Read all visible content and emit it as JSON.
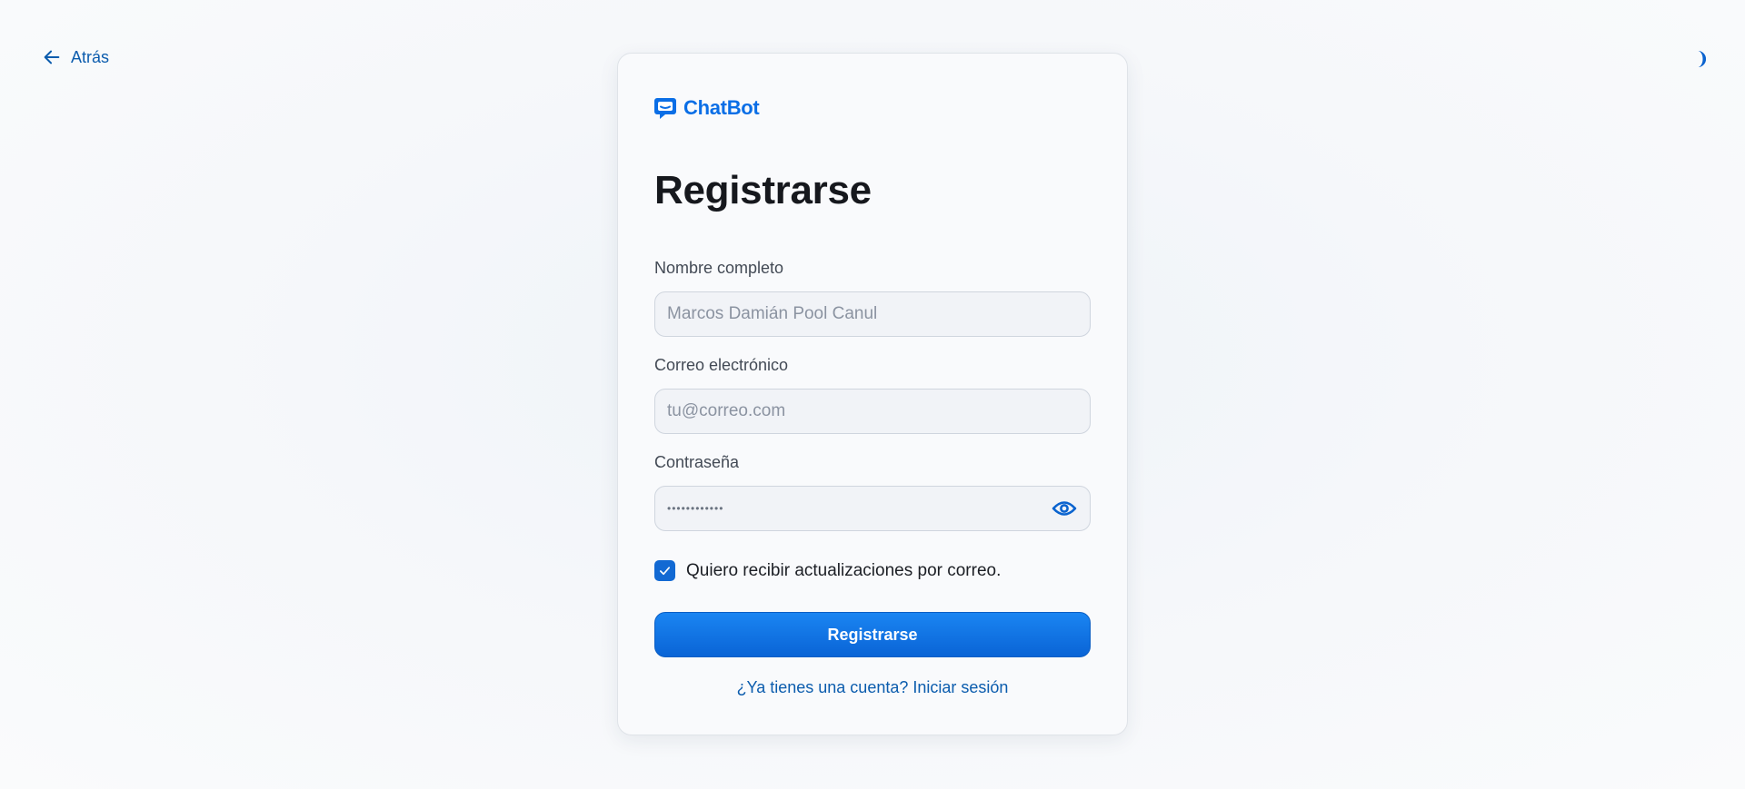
{
  "nav": {
    "back_label": "Atrás"
  },
  "logo": {
    "text": "ChatBot",
    "icon": "chat-bubble-icon"
  },
  "form": {
    "title": "Registrarse",
    "name": {
      "label": "Nombre completo",
      "placeholder": "Marcos Damián Pool Canul",
      "value": ""
    },
    "email": {
      "label": "Correo electrónico",
      "placeholder": "tu@correo.com",
      "value": ""
    },
    "password": {
      "label": "Contraseña",
      "value": "••••••••••••",
      "toggle_icon": "eye-icon"
    },
    "newsletter": {
      "label": "Quiero recibir actualizaciones por correo.",
      "checked": true
    },
    "submit_label": "Registrarse",
    "login_link": "¿Ya tienes una cuenta? Iniciar sesión"
  },
  "theme_toggle": {
    "icon": "half-moon-icon"
  },
  "colors": {
    "accent": "#0a6ee6",
    "link": "#0b5cad",
    "title": "#16181d"
  }
}
